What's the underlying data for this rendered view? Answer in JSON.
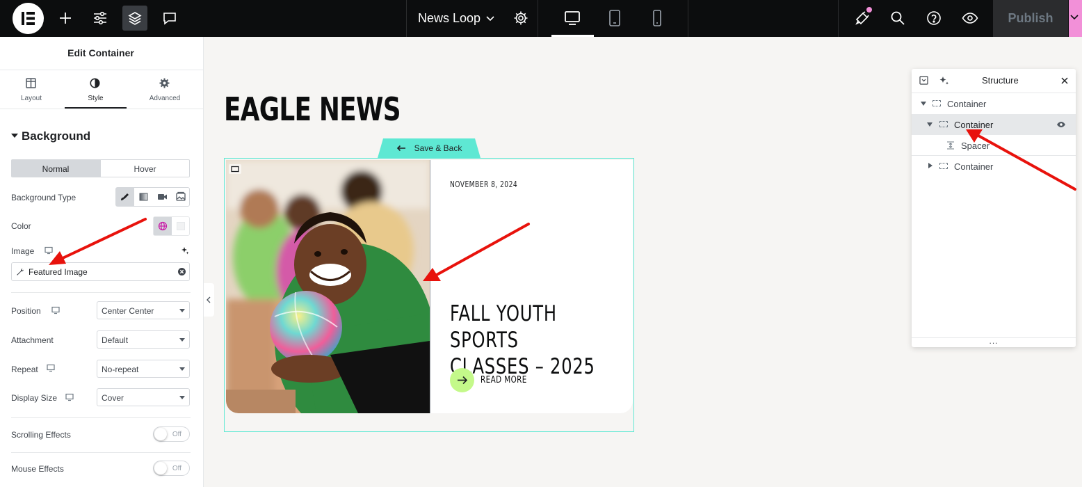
{
  "topbar": {
    "doc_title": "News Loop",
    "publish_label": "Publish",
    "icons": [
      "elementor-logo-icon",
      "add-icon",
      "sliders-icon",
      "layers-icon",
      "chat-icon",
      "chevron-down-icon",
      "gear-icon",
      "desktop-icon",
      "tablet-icon",
      "mobile-icon",
      "megaphone-icon",
      "search-icon",
      "help-icon",
      "eye-icon"
    ]
  },
  "panel": {
    "title": "Edit Container",
    "tabs": [
      {
        "label": "Layout",
        "icon": "layout-icon"
      },
      {
        "label": "Style",
        "icon": "contrast-icon"
      },
      {
        "label": "Advanced",
        "icon": "gear-icon"
      }
    ],
    "section_title": "Background",
    "state_tabs": [
      "Normal",
      "Hover"
    ],
    "background_type_label": "Background Type",
    "color_label": "Color",
    "image_label": "Image",
    "image_value": "Featured Image",
    "position_label": "Position",
    "position_value": "Center Center",
    "attachment_label": "Attachment",
    "attachment_value": "Default",
    "repeat_label": "Repeat",
    "repeat_value": "No-repeat",
    "display_size_label": "Display Size",
    "display_size_value": "Cover",
    "scrolling_label": "Scrolling Effects",
    "scrolling_value": "Off",
    "mouse_label": "Mouse Effects",
    "mouse_value": "Off"
  },
  "canvas": {
    "heading": "EAGLE NEWS",
    "save_back": "Save & Back",
    "post_date": "NOVEMBER 8, 2024",
    "post_title_line1": "FALL YOUTH SPORTS",
    "post_title_line2": "CLASSES – 2025",
    "read_more": "READ MORE"
  },
  "structure": {
    "title": "Structure",
    "items": [
      {
        "label": "Container"
      },
      {
        "label": "Container"
      },
      {
        "label": "Spacer"
      },
      {
        "label": "Container"
      }
    ],
    "footer": "..."
  },
  "colors": {
    "accent_teal": "#5ee8d3",
    "read_more_green": "#c4f98a",
    "arrow_red": "#e8120c",
    "notification_pink": "#f290d8",
    "topbar_bg": "#0c0d0e"
  }
}
